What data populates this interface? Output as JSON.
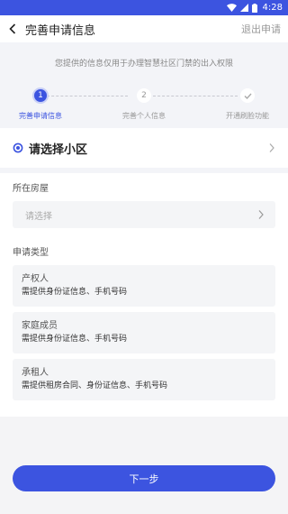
{
  "status_bar": {
    "time": "4:28"
  },
  "header": {
    "title": "完善申请信息",
    "exit_label": "退出申请"
  },
  "notice": "您提供的信息仅用于办理智慧社区门禁的出入权限",
  "steps": [
    {
      "number": "1",
      "label": "完善申请信息",
      "state": "active"
    },
    {
      "number": "2",
      "label": "完善个人信息",
      "state": "pending"
    },
    {
      "number": "",
      "label": "开通刷脸功能",
      "state": "pending"
    }
  ],
  "community": {
    "label": "请选择小区"
  },
  "house": {
    "label": "所在房屋",
    "placeholder": "请选择"
  },
  "apply_type": {
    "label": "申请类型",
    "options": [
      {
        "title": "产权人",
        "desc": "需提供身份证信息、手机号码"
      },
      {
        "title": "家庭成员",
        "desc": "需提供身份证信息、手机号码"
      },
      {
        "title": "承租人",
        "desc": "需提供租房合同、身份证信息、手机号码"
      }
    ]
  },
  "next_button": "下一步",
  "colors": {
    "accent": "#3c54e0",
    "background": "#f3f4f8"
  }
}
